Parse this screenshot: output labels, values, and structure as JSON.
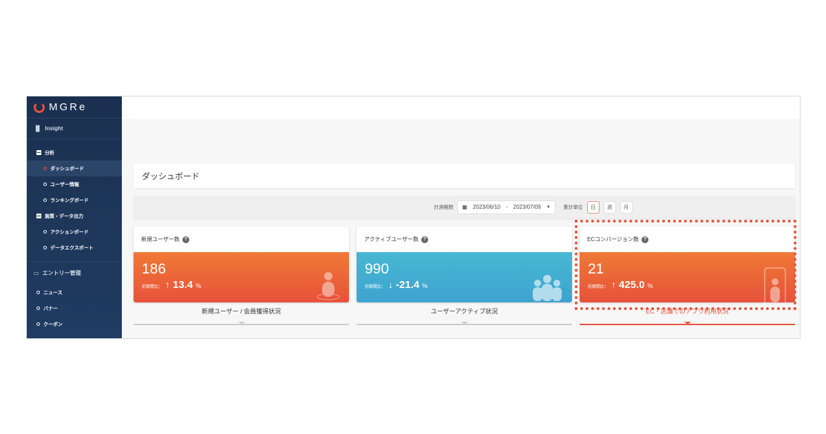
{
  "brand": "MGRe",
  "sidebar": {
    "insight": "Insight",
    "sections": [
      {
        "label": "分析",
        "items": [
          "ダッシュボード",
          "ユーザー情報",
          "ランキングボード"
        ]
      },
      {
        "label": "施策・データ出力",
        "items": [
          "アクションボード",
          "データエクスポート"
        ]
      }
    ],
    "entry": "エントリー管理",
    "entry_items": [
      "ニュース",
      "バナー",
      "クーポン"
    ]
  },
  "page_title": "ダッシュボード",
  "filter": {
    "period_label": "計測期間",
    "start": "2023/06/10",
    "sep": "-",
    "end": "2023/07/09",
    "unit_label": "集計単位",
    "units": [
      "日",
      "週",
      "月"
    ]
  },
  "cards": [
    {
      "title": "新規ユーザー数",
      "value": "186",
      "cmp_label": "前期間比：",
      "arrow": "↑",
      "pct": "13.4",
      "unit": "%",
      "tab": "新規ユーザー / 会員獲得状況"
    },
    {
      "title": "アクティブユーザー数",
      "value": "990",
      "cmp_label": "前期間比：",
      "arrow": "↓",
      "pct": "-21.4",
      "unit": "%",
      "tab": "ユーザーアクティブ状況"
    },
    {
      "title": "ECコンバージョン数",
      "value": "21",
      "cmp_label": "前期間比：",
      "arrow": "↑",
      "pct": "425.0",
      "unit": "%",
      "tab": "EC・店舗でのアプリ利用状況"
    }
  ],
  "colors": {
    "accent": "#e8513a",
    "blue": "#3ea3cf",
    "sidebar": "#1b3050"
  }
}
